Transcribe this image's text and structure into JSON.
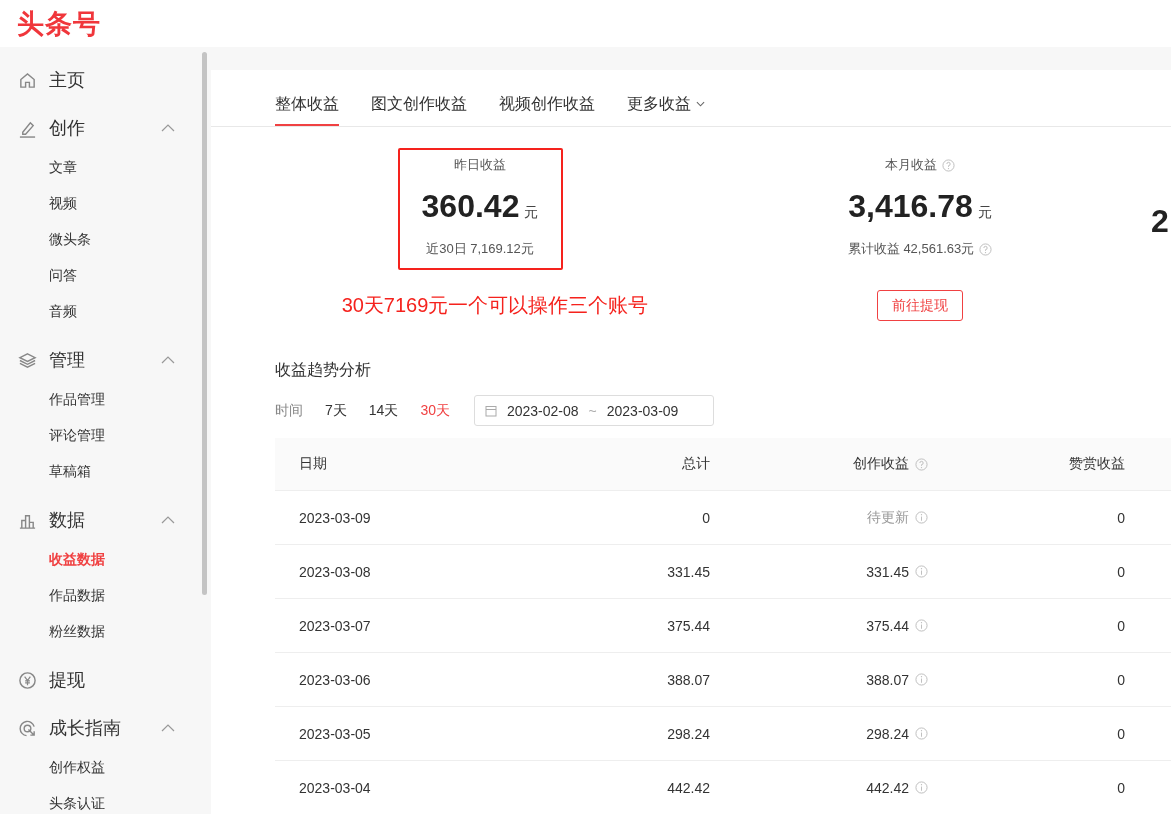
{
  "logo": "头条号",
  "sidebar": {
    "sections": [
      {
        "label": "主页"
      },
      {
        "label": "创作",
        "expanded": true,
        "children": [
          {
            "label": "文章",
            "selected": false
          },
          {
            "label": "视频",
            "selected": false
          },
          {
            "label": "微头条",
            "selected": false
          },
          {
            "label": "问答",
            "selected": false
          },
          {
            "label": "音频",
            "selected": false
          }
        ]
      },
      {
        "label": "管理",
        "expanded": true,
        "children": [
          {
            "label": "作品管理",
            "selected": false
          },
          {
            "label": "评论管理",
            "selected": false
          },
          {
            "label": "草稿箱",
            "selected": false
          }
        ]
      },
      {
        "label": "数据",
        "expanded": true,
        "children": [
          {
            "label": "收益数据",
            "selected": true
          },
          {
            "label": "作品数据",
            "selected": false
          },
          {
            "label": "粉丝数据",
            "selected": false
          }
        ]
      },
      {
        "label": "提现"
      },
      {
        "label": "成长指南",
        "expanded": true,
        "children": [
          {
            "label": "创作权益",
            "selected": false
          },
          {
            "label": "头条认证",
            "selected": false
          }
        ]
      }
    ]
  },
  "tabs": [
    {
      "label": "整体收益",
      "selected": true,
      "kind": "plain"
    },
    {
      "label": "图文创作收益",
      "selected": false,
      "kind": "plain"
    },
    {
      "label": "视频创作收益",
      "selected": false,
      "kind": "plain"
    },
    {
      "label": "更多收益",
      "selected": false,
      "kind": "dropdown"
    }
  ],
  "stats": [
    {
      "label": "昨日收益",
      "value": "360.42",
      "unit": "元",
      "sub": "近30日 7,169.12元",
      "highlighted": true,
      "help": false
    },
    {
      "label": "本月收益",
      "value": "3,416.78",
      "unit": "元",
      "sub": "累计收益 42,561.63元",
      "highlighted": false,
      "help": true,
      "button": "前往提现"
    },
    {
      "value": "2"
    }
  ],
  "annotation": "30天7169元一个可以操作三个账号",
  "trend": {
    "title": "收益趋势分析",
    "range_label": "时间",
    "ranges": [
      {
        "label": "7天",
        "selected": false
      },
      {
        "label": "14天",
        "selected": false
      },
      {
        "label": "30天",
        "selected": true
      }
    ],
    "date_start": "2023-02-08",
    "date_separator": "~",
    "date_end": "2023-03-09"
  },
  "table": {
    "columns": [
      {
        "label": "日期",
        "help": false
      },
      {
        "label": "总计",
        "help": false
      },
      {
        "label": "创作收益",
        "help": true
      },
      {
        "label": "赞赏收益",
        "help": false
      }
    ],
    "rows": [
      {
        "date": "2023-03-09",
        "total": "0",
        "creation": "待更新",
        "creation_pending": true,
        "reward": "0"
      },
      {
        "date": "2023-03-08",
        "total": "331.45",
        "creation": "331.45",
        "creation_pending": false,
        "reward": "0"
      },
      {
        "date": "2023-03-07",
        "total": "375.44",
        "creation": "375.44",
        "creation_pending": false,
        "reward": "0"
      },
      {
        "date": "2023-03-06",
        "total": "388.07",
        "creation": "388.07",
        "creation_pending": false,
        "reward": "0"
      },
      {
        "date": "2023-03-05",
        "total": "298.24",
        "creation": "298.24",
        "creation_pending": false,
        "reward": "0"
      },
      {
        "date": "2023-03-04",
        "total": "442.42",
        "creation": "442.42",
        "creation_pending": false,
        "reward": "0"
      }
    ]
  }
}
